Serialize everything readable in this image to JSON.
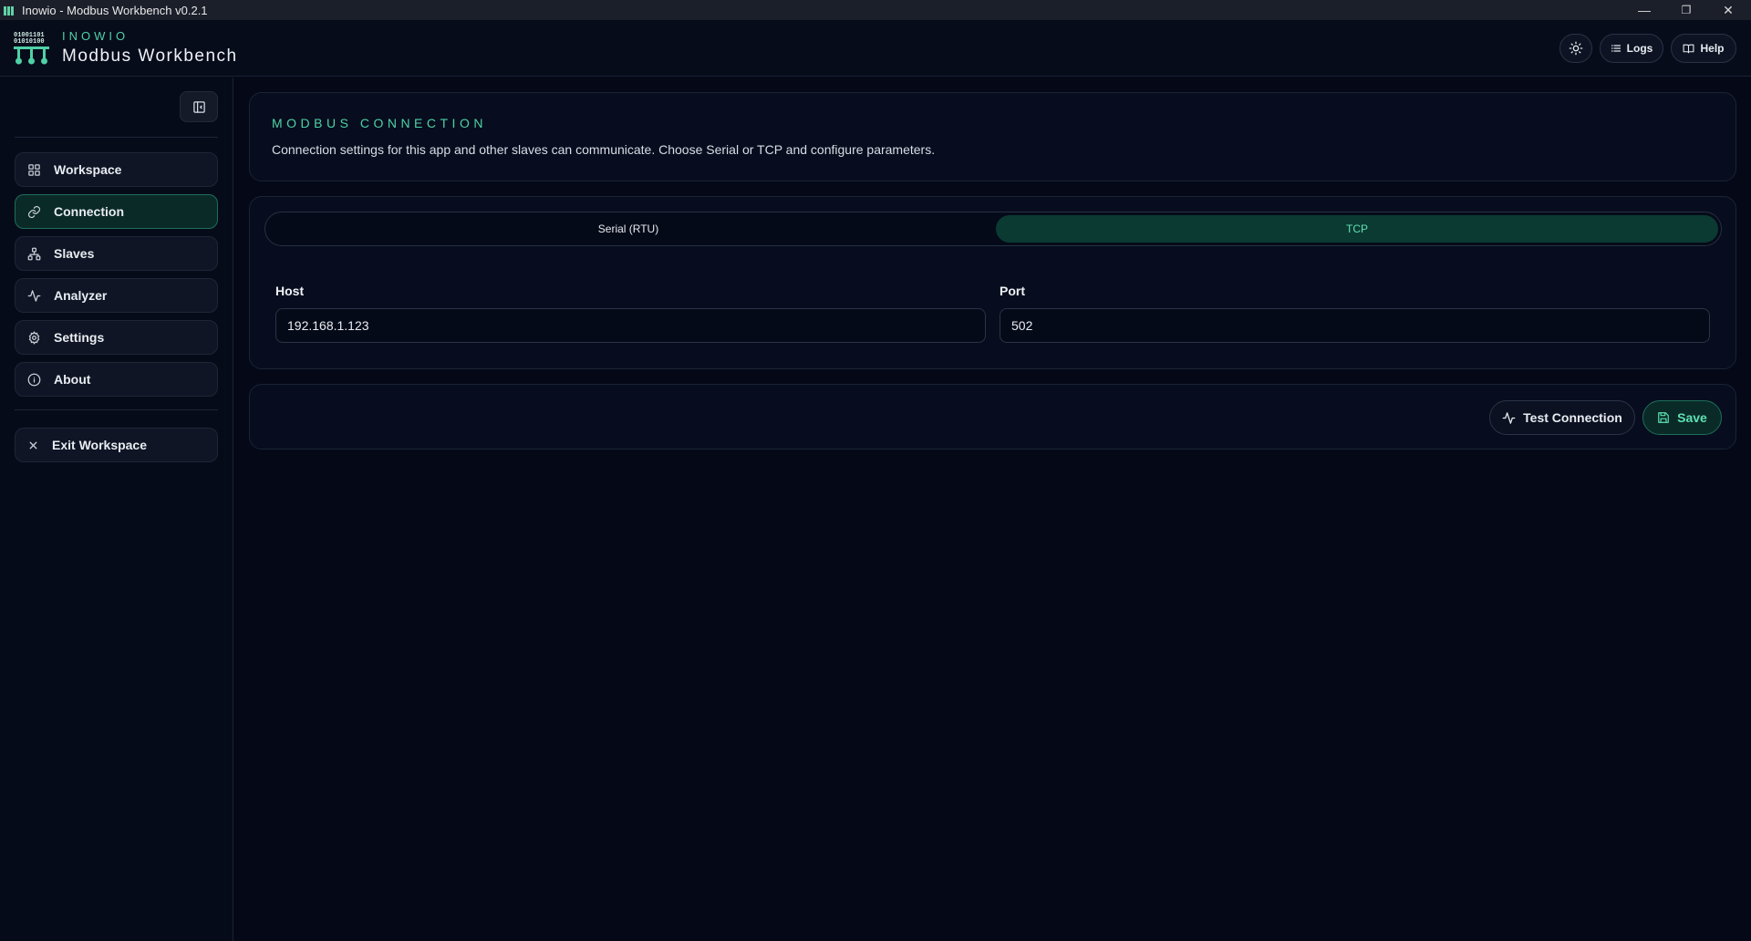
{
  "window": {
    "title": "Inowio - Modbus Workbench v0.2.1",
    "controls": {
      "minimize": "—",
      "maximize": "❐",
      "close": "✕"
    }
  },
  "header": {
    "brand_small": "INOWIO",
    "brand_title": "Modbus Workbench",
    "logo_bits": [
      "01001101",
      "01010100"
    ],
    "logs_label": "Logs",
    "help_label": "Help"
  },
  "sidebar": {
    "items": [
      {
        "label": "Workspace",
        "icon": "grid-icon"
      },
      {
        "label": "Connection",
        "icon": "link-icon",
        "active": true
      },
      {
        "label": "Slaves",
        "icon": "network-icon"
      },
      {
        "label": "Analyzer",
        "icon": "activity-icon"
      },
      {
        "label": "Settings",
        "icon": "gear-icon"
      },
      {
        "label": "About",
        "icon": "info-icon"
      }
    ],
    "exit_label": "Exit Workspace"
  },
  "connection": {
    "title": "MODBUS CONNECTION",
    "description": "Connection settings for this app and other slaves can communicate. Choose Serial or TCP and configure parameters.",
    "modes": [
      "Serial (RTU)",
      "TCP"
    ],
    "selected_mode": "TCP",
    "host_label": "Host",
    "host_value": "192.168.1.123",
    "port_label": "Port",
    "port_value": "502"
  },
  "actions": {
    "test_label": "Test Connection",
    "save_label": "Save"
  },
  "colors": {
    "accent": "#4fd1a5",
    "background": "#040817",
    "card": "#070d1e",
    "active_nav": "#0a2a27"
  }
}
